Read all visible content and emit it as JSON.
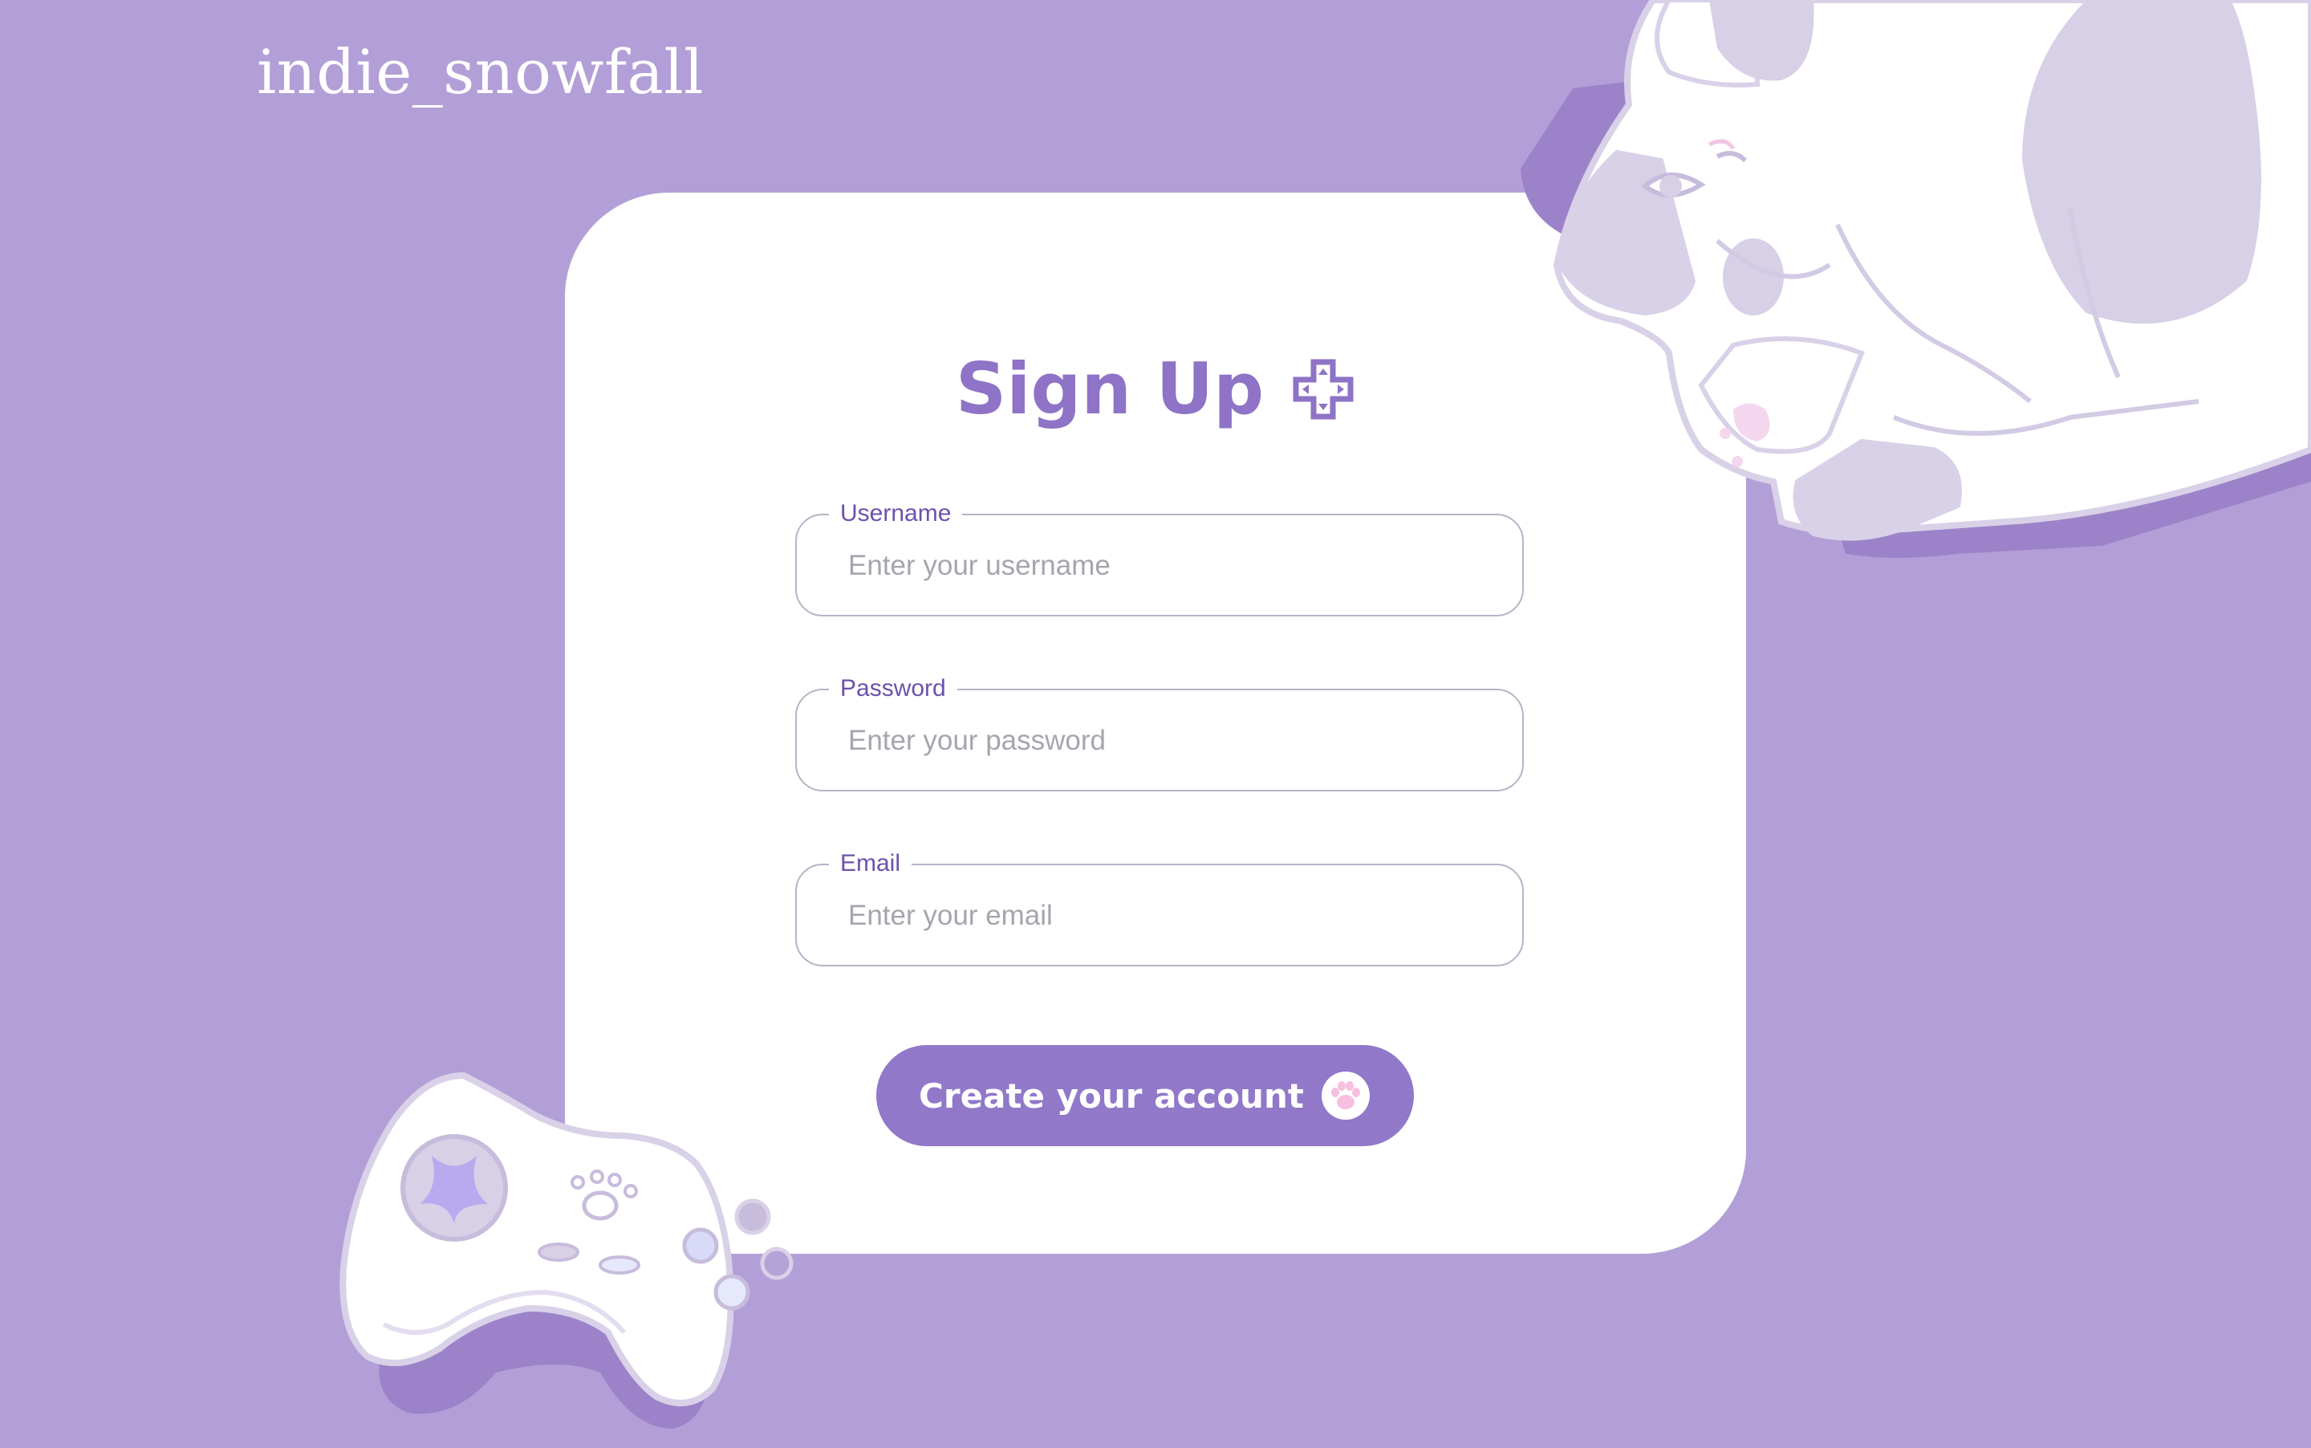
{
  "brand": {
    "logo_text": "indie_snowfall"
  },
  "form": {
    "title": "Sign Up",
    "fields": [
      {
        "label": "Username",
        "placeholder": "Enter your username"
      },
      {
        "label": "Password",
        "placeholder": "Enter your password"
      },
      {
        "label": "Email",
        "placeholder": "Enter your email"
      }
    ],
    "submit_label": "Create your account"
  },
  "icons": {
    "title_icon": "dpad-plus-icon",
    "submit_icon": "cat-paw-icon",
    "illustration_top": "sleeping-dog-illustration",
    "illustration_bottom": "game-controller-illustration"
  },
  "colors": {
    "background": "#b39fd7",
    "card": "#ffffff",
    "accent": "#9178c9",
    "title": "#8e73c6",
    "label": "#6c51ad"
  }
}
